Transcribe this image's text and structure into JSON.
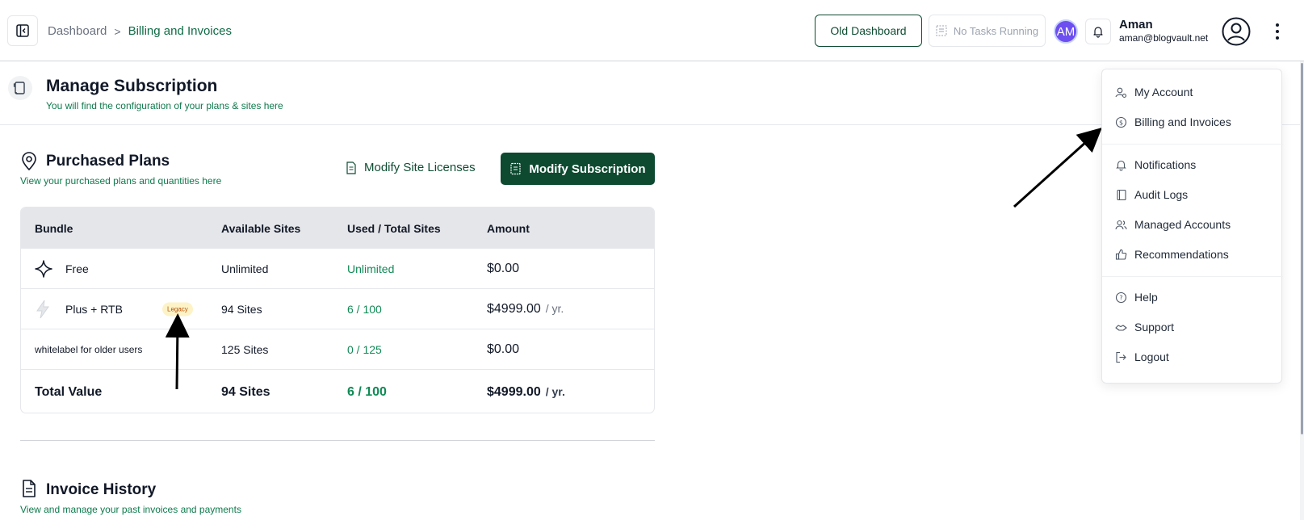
{
  "breadcrumb": {
    "home": "Dashboard",
    "separator": ">",
    "current": "Billing and Invoices"
  },
  "header": {
    "old_dashboard": "Old Dashboard",
    "tasks": "No Tasks Running",
    "avatar_initials": "AM",
    "user_name": "Aman",
    "user_email": "aman@blogvault.net"
  },
  "page": {
    "title": "Manage Subscription",
    "subtitle": "You will find the configuration of your plans & sites here"
  },
  "plans": {
    "title": "Purchased Plans",
    "subtitle": "View your purchased plans and quantities here",
    "modify_licenses": "Modify Site Licenses",
    "modify_subscription": "Modify Subscription",
    "columns": [
      "Bundle",
      "Available Sites",
      "Used / Total Sites",
      "Amount"
    ],
    "rows": [
      {
        "bundle": "Free",
        "available": "Unlimited",
        "used": "Unlimited",
        "amount": "$0.00",
        "per": ""
      },
      {
        "bundle": "Plus + RTB",
        "badge": "Legacy",
        "available": "94 Sites",
        "used": "6 / 100",
        "amount": "$4999.00",
        "per": "/ yr."
      },
      {
        "bundle": "whitelabel for older users",
        "available": "125 Sites",
        "used": "0 / 125",
        "amount": "$0.00",
        "per": ""
      }
    ],
    "total": {
      "label": "Total Value",
      "available": "94 Sites",
      "used": "6 / 100",
      "amount": "$4999.00",
      "per": "/ yr."
    }
  },
  "invoices": {
    "title": "Invoice History",
    "subtitle": "View and manage your past invoices and payments"
  },
  "menu": {
    "items": [
      "My Account",
      "Billing and Invoices",
      "Notifications",
      "Audit Logs",
      "Managed Accounts",
      "Recommendations",
      "Help",
      "Support",
      "Logout"
    ]
  },
  "colors": {
    "brand_dark": "#0d4a30",
    "brand_green": "#0f8a55",
    "legacy_bg": "#fef3c7",
    "avatar": "#6d4ff0"
  },
  "icons": [
    "sidebar-toggle-icon",
    "tasks-icon",
    "bell-icon",
    "user-circle-icon",
    "kebab-icon",
    "scroll-icon",
    "map-pin-icon",
    "document-icon",
    "sparkle-icon",
    "bolt-icon",
    "user-cog-icon",
    "dollar-circle-icon",
    "notebook-icon",
    "users-icon",
    "thumbs-up-icon",
    "help-circle-icon",
    "handshake-icon",
    "logout-icon"
  ]
}
